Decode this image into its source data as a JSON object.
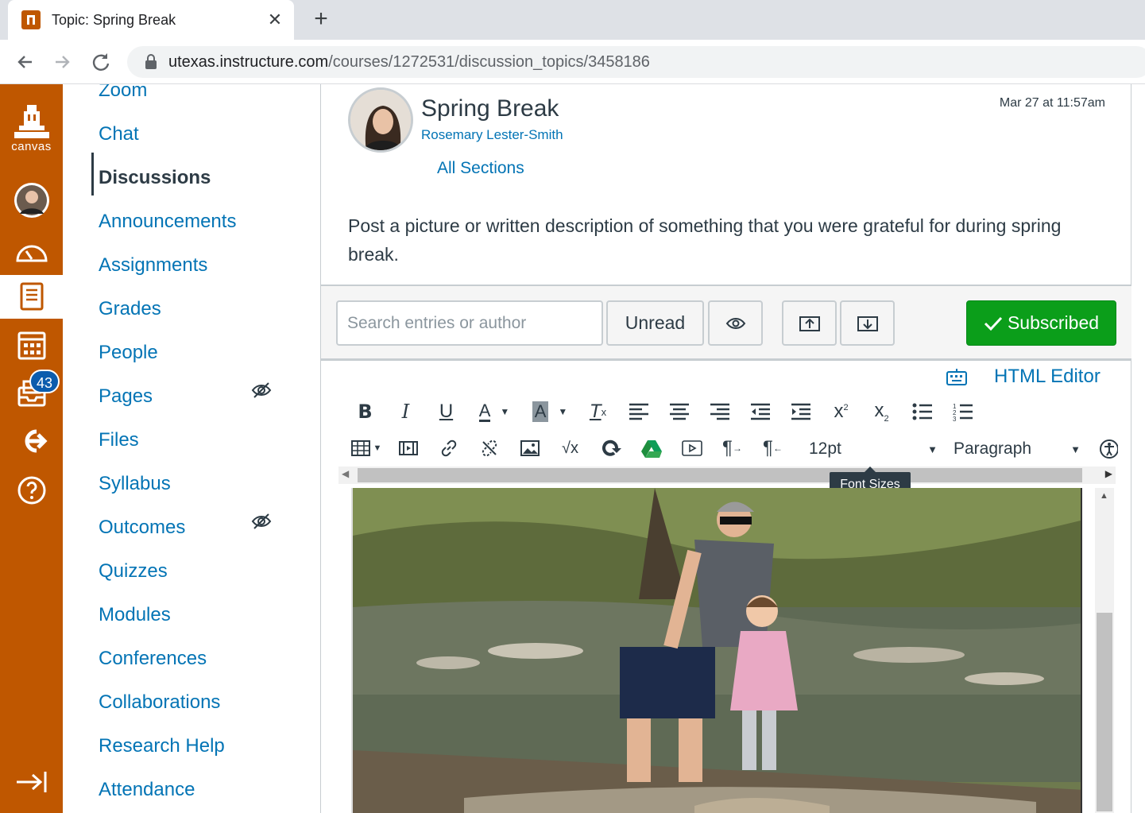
{
  "browser": {
    "tab_title": "Topic: Spring Break",
    "url_host": "utexas.instructure.com",
    "url_path": "/courses/1272531/discussion_topics/3458186"
  },
  "global_nav": {
    "logo_text": "canvas",
    "inbox_badge": "43",
    "brand_color": "#bf5700"
  },
  "course_nav": {
    "items": [
      {
        "label": "Zoom"
      },
      {
        "label": "Chat"
      },
      {
        "label": "Discussions",
        "active": true
      },
      {
        "label": "Announcements"
      },
      {
        "label": "Assignments"
      },
      {
        "label": "Grades"
      },
      {
        "label": "People"
      },
      {
        "label": "Pages",
        "hidden": true
      },
      {
        "label": "Files"
      },
      {
        "label": "Syllabus"
      },
      {
        "label": "Outcomes",
        "hidden": true
      },
      {
        "label": "Quizzes"
      },
      {
        "label": "Modules"
      },
      {
        "label": "Conferences"
      },
      {
        "label": "Collaborations"
      },
      {
        "label": "Research Help"
      },
      {
        "label": "Attendance"
      }
    ]
  },
  "topic": {
    "title": "Spring Break",
    "author": "Rosemary Lester-Smith",
    "timestamp": "Mar 27 at 11:57am",
    "sections": "All Sections",
    "message": "Post a picture or written description of something that you were grateful for during spring break."
  },
  "toolbar": {
    "search_placeholder": "Search entries or author",
    "unread_label": "Unread",
    "subscribed_label": "Subscribed",
    "subscribed_color": "#0b9e1a"
  },
  "editor": {
    "html_editor_label": "HTML Editor",
    "font_size": "12pt",
    "block_format": "Paragraph",
    "tooltip": "Font Sizes"
  }
}
